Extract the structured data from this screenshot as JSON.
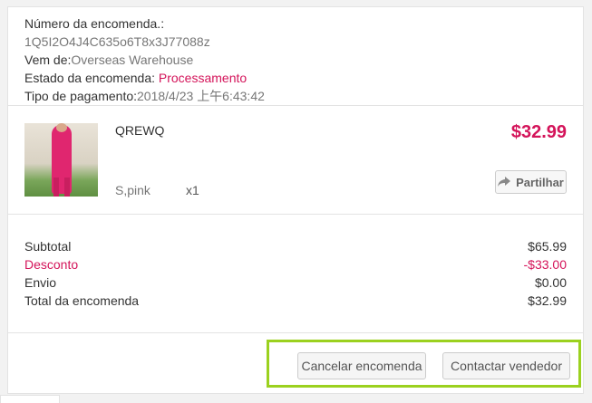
{
  "order": {
    "number_label": "Número da encomenda.:",
    "number_value": "1Q5I2O4J4C635o6T8x3J77088z",
    "from_label": "Vem de:",
    "from_value": "Overseas Warehouse",
    "status_label": "Estado da encomenda: ",
    "status_value": "Processamento",
    "payment_label": "Tipo de pagamento:",
    "payment_value": "2018/4/23 上午6:43:42"
  },
  "product": {
    "name": "QREWQ",
    "variant": "S,pink",
    "quantity": "x1",
    "price": "$32.99",
    "share_label": "Partilhar",
    "share_icon": "share-arrow-icon"
  },
  "totals": [
    {
      "label": "Subtotal",
      "value": "$65.99"
    },
    {
      "label": "Desconto",
      "value": "-$33.00"
    },
    {
      "label": "Envio",
      "value": "$0.00"
    },
    {
      "label": "Total da encomenda",
      "value": "$32.99"
    }
  ],
  "actions": {
    "cancel_label": "Cancelar encomenda",
    "contact_label": "Contactar vendedor"
  },
  "colors": {
    "accent": "#d4145a",
    "highlight_border": "#9bd11f"
  }
}
